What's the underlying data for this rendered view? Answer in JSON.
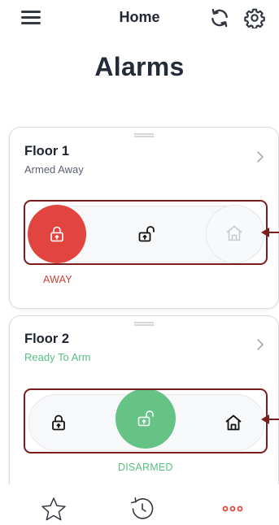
{
  "header": {
    "title": "Home"
  },
  "page": {
    "title": "Alarms"
  },
  "cards": [
    {
      "name": "Floor 1",
      "status": "Armed Away",
      "status_color": "#5b6270",
      "mode_label": "AWAY",
      "mode_color": "#c9423e"
    },
    {
      "name": "Floor 2",
      "status": "Ready To Arm",
      "status_color": "#58c07e",
      "mode_label": "DISARMED",
      "mode_color": "#58c07e"
    }
  ],
  "icons": {
    "menu": "menu-icon",
    "refresh": "refresh-icon",
    "settings": "gear-icon",
    "chevron": "chevron-right-icon",
    "locked": "lock-icon",
    "unlocked": "unlock-icon",
    "home": "home-icon",
    "favorites": "star-icon",
    "history": "history-icon",
    "more": "more-icon"
  },
  "colors": {
    "away_red": "#e2453f",
    "disarmed_green": "#66c386",
    "highlight": "#7c1d1d",
    "more_red": "#e2453f"
  }
}
